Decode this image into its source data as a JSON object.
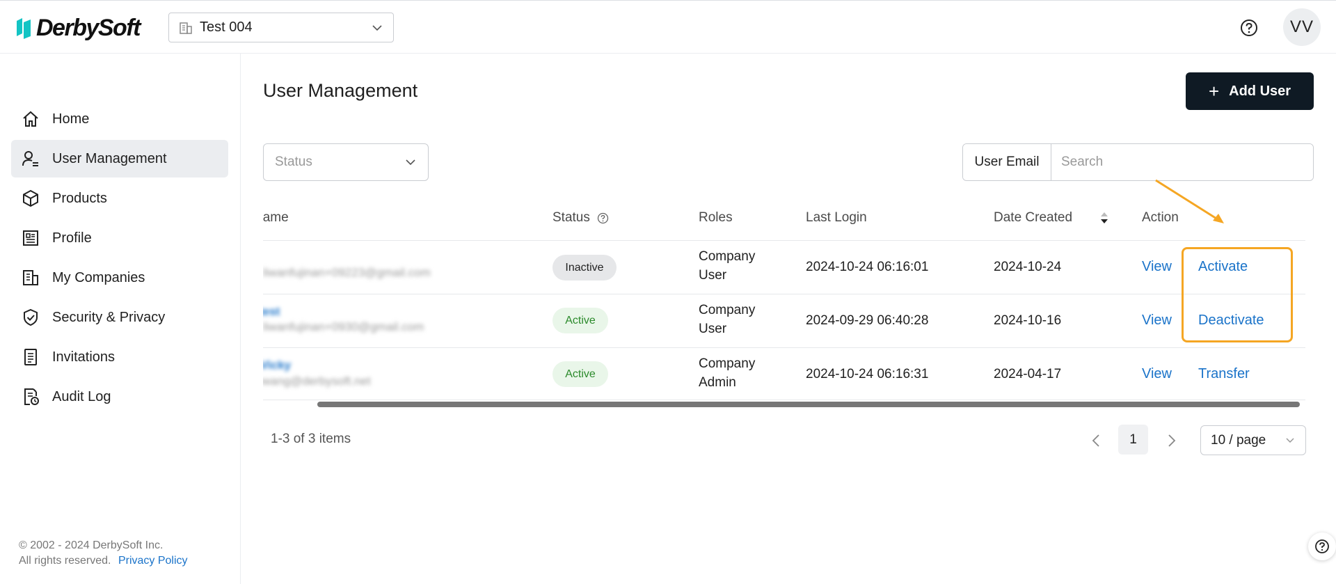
{
  "header": {
    "logo_text": "DerbySoft",
    "company_selector_value": "Test 004",
    "avatar_initials": "VV"
  },
  "sidebar": {
    "items": [
      {
        "label": "Home",
        "icon": "home-icon"
      },
      {
        "label": "User Management",
        "icon": "user-list-icon",
        "active": true
      },
      {
        "label": "Products",
        "icon": "cube-icon"
      },
      {
        "label": "Profile",
        "icon": "profile-card-icon"
      },
      {
        "label": "My Companies",
        "icon": "building-icon"
      },
      {
        "label": "Security & Privacy",
        "icon": "shield-check-icon"
      },
      {
        "label": "Invitations",
        "icon": "document-icon"
      },
      {
        "label": "Audit Log",
        "icon": "audit-clock-icon"
      }
    ],
    "footer": {
      "copyright": "© 2002 - 2024 DerbySoft Inc.",
      "rights": "All rights reserved.",
      "privacy_link": "Privacy Policy"
    }
  },
  "main": {
    "title": "User Management",
    "add_button_label": "Add User",
    "status_filter_placeholder": "Status",
    "search_label": "User Email",
    "search_placeholder": "Search"
  },
  "table": {
    "columns": {
      "name": "Name",
      "status": "Status",
      "roles": "Roles",
      "last_login": "Last Login",
      "date_created": "Date Created",
      "action": "Action"
    },
    "rows": [
      {
        "name": "",
        "email": "liwanfujinan+09223@gmail.com",
        "status": "Inactive",
        "role_line1": "Company",
        "role_line2": "User",
        "last_login": "2024-10-24 06:16:01",
        "date_created": "2024-10-24",
        "action_view": "View",
        "action_secondary": "Activate"
      },
      {
        "name": "test",
        "email": "liwanfujinan+0930@gmail.com",
        "status": "Active",
        "role_line1": "Company",
        "role_line2": "User",
        "last_login": "2024-09-29 06:40:28",
        "date_created": "2024-10-16",
        "action_view": "View",
        "action_secondary": "Deactivate"
      },
      {
        "name": "Vicky",
        "email": "vwang@derbysoft.net",
        "status": "Active",
        "role_line1": "Company",
        "role_line2": "Admin",
        "last_login": "2024-10-24 06:16:31",
        "date_created": "2024-04-17",
        "action_view": "View",
        "action_secondary": "Transfer"
      }
    ]
  },
  "pagination": {
    "items_text": "1-3 of 3 items",
    "current_page": "1",
    "page_size": "10 / page"
  },
  "colors": {
    "accent_link": "#1a73c9",
    "primary_button": "#0f1a24",
    "highlight_annotation": "#f5a623",
    "active_badge_text": "#2b8a2b"
  }
}
